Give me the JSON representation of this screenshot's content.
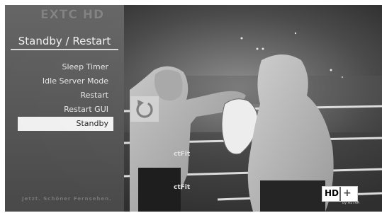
{
  "channel_logo": "EXTC HD",
  "menu": {
    "title": "Standby / Restart",
    "items": [
      {
        "label": "Sleep Timer",
        "selected": false
      },
      {
        "label": "Idle Server Mode",
        "selected": false
      },
      {
        "label": "Restart",
        "selected": false
      },
      {
        "label": "Restart GUI",
        "selected": false
      },
      {
        "label": "Standby",
        "selected": true
      }
    ],
    "footer": "Jetzt. Schöner Fernsehen."
  },
  "restart_icon": "restart-icon",
  "badge": {
    "hd": "HD",
    "plus": "+",
    "sub": "by ASTRA"
  }
}
